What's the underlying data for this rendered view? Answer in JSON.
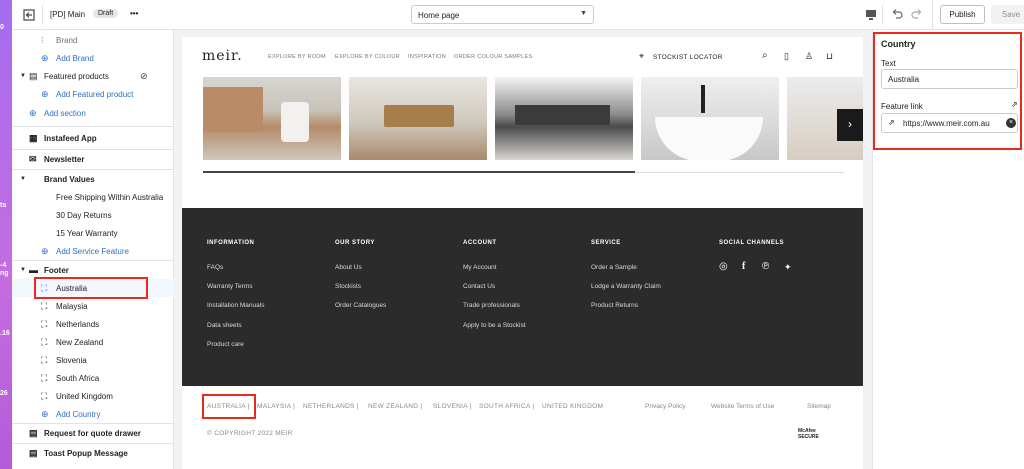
{
  "left_strip": {
    "labels": [
      "0",
      "ts",
      "-4",
      "ng",
      ".16",
      "26"
    ]
  },
  "topbar": {
    "theme_name": "[PD] Main",
    "status_badge": "Draft",
    "more_label": "•••",
    "page_select": "Home page",
    "publish_label": "Publish",
    "save_label": "Save"
  },
  "sidebar": {
    "brand": "Brand",
    "add_brand": "Add Brand",
    "featured_products": "Featured products",
    "add_featured_product": "Add Featured product",
    "add_section": "Add section",
    "instafeed": "Instafeed App",
    "newsletter": "Newsletter",
    "brand_values": "Brand Values",
    "bv_items": [
      "Free Shipping Within Australia",
      "30 Day Returns",
      "15 Year Warranty"
    ],
    "add_service_feature": "Add Service Feature",
    "footer": "Footer",
    "countries": [
      "Australia",
      "Malaysia",
      "Netherlands",
      "New Zealand",
      "Slovenia",
      "South Africa",
      "United Kingdom"
    ],
    "add_country": "Add Country",
    "request_quote": "Request for quote drawer",
    "toast_popup": "Toast Popup Message"
  },
  "preview": {
    "logo": "meir.",
    "nav": [
      "EXPLORE BY ROOM",
      "EXPLORE BY COLOUR",
      "INSPIRATION",
      "ORDER COLOUR SAMPLES"
    ],
    "stockist": "STOCKIST LOCATOR",
    "footer_columns": [
      {
        "title": "INFORMATION",
        "links": [
          "FAQs",
          "Warranty Terms",
          "Installation Manuals",
          "Data sheets",
          "Product care"
        ]
      },
      {
        "title": "OUR STORY",
        "links": [
          "About Us",
          "Stockists",
          "Order Catalogues"
        ]
      },
      {
        "title": "ACCOUNT",
        "links": [
          "My Account",
          "Contact Us",
          "Trade professionals",
          "Apply to be a Stockist"
        ]
      },
      {
        "title": "SERVICE",
        "links": [
          "Order a Sample",
          "Lodge a Warranty Claim",
          "Product Returns"
        ]
      },
      {
        "title": "SOCIAL CHANNELS",
        "links": []
      }
    ],
    "countries": [
      "AUSTRALIA |",
      "MALAYSIA |",
      "NETHERLANDS |",
      "NEW ZEALAND |",
      "SLOVENIA |",
      "SOUTH AFRICA |",
      "UNITED KINGDOM"
    ],
    "legal": [
      "Privacy Policy",
      "Website Terms of Use",
      "Sitemap"
    ],
    "copyright": "© COPYRIGHT 2022 MEIR",
    "mcafee": [
      "McAfee",
      "SECURE"
    ]
  },
  "panel": {
    "heading": "Country",
    "text_label": "Text",
    "text_value": "Australia",
    "link_label": "Feature link",
    "link_value": "https://www.meir.com.au"
  }
}
